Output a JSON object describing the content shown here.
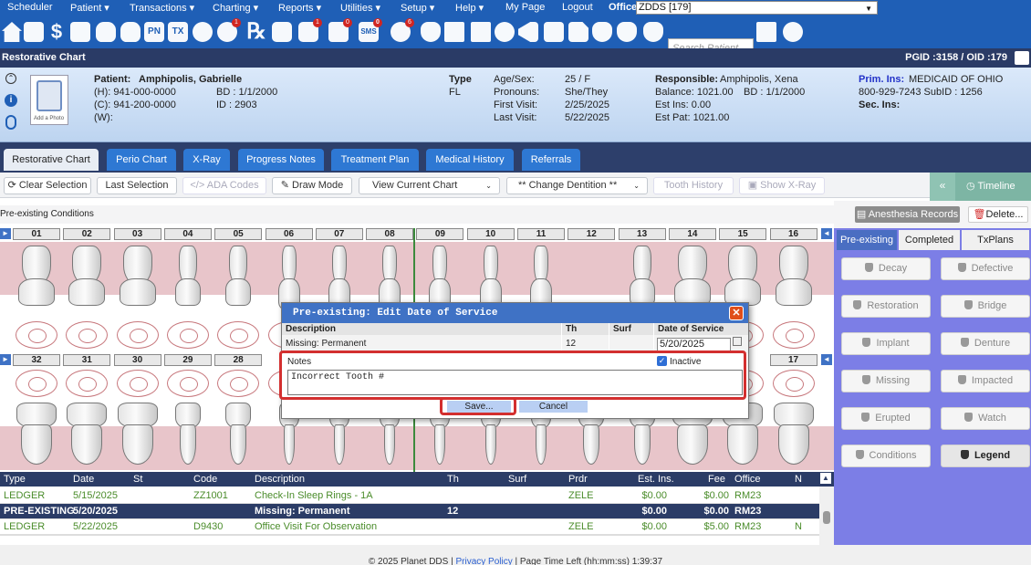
{
  "menu": {
    "items": [
      "Scheduler",
      "Patient ▾",
      "Transactions ▾",
      "Charting ▾",
      "Reports ▾",
      "Utilities ▾",
      "Setup ▾",
      "Help ▾",
      "My Page",
      "Logout"
    ],
    "office_label": "Office",
    "office_value": "ZDDS [179]"
  },
  "toolbar_icons": [
    "home-icon",
    "calendar-icon",
    "dollar-icon",
    "pen-icon",
    "tooth-icon",
    "tooth-alt-icon",
    "pn-icon",
    "tx-icon",
    "add-person-icon",
    "globe-alert-icon",
    "rx-icon",
    "message-icon",
    "chat-alert-icon",
    "notes-icon",
    "sms-icon",
    "refresh-icon",
    "insurance-icon",
    "sort-icon",
    "chart-icon",
    "globe-icon",
    "megaphone-icon",
    "printer-icon",
    "document-icon",
    "shield-check-icon",
    "arrow-shield-icon",
    "chevron-shield-icon"
  ],
  "toolbar_badges": {
    "globe_alert": "1",
    "chat_alert": "1",
    "notes": "0",
    "sms": "0",
    "refresh": "6"
  },
  "toolbar_labels": {
    "pn": "PN",
    "tx": "TX",
    "rx": "℞",
    "sms": "SMS"
  },
  "search_placeholder": "Search Patient...",
  "titlebar": {
    "title": "Restorative Chart",
    "ids": "PGID :3158  /  OID :179"
  },
  "patient": {
    "label": "Patient:",
    "name": "Amphipolis, Gabrielle",
    "home": "(H):  941-000-0000",
    "cell": "(C):  941-200-0000",
    "work": "(W):",
    "bd": "BD  :  1/1/2000",
    "id": "ID  :  2903",
    "add_photo": "Add a Photo",
    "type_label": "Type",
    "type_value": "FL",
    "age_sex_label": "Age/Sex:",
    "age_sex_value": "25 / F",
    "pronouns_label": "Pronouns:",
    "pronouns_value": "She/They",
    "first_visit_label": "First Visit:",
    "first_visit_value": "2/25/2025",
    "last_visit_label": "Last Visit:",
    "last_visit_value": "5/22/2025",
    "responsible_label": "Responsible:",
    "responsible_value": "Amphipolis, Xena",
    "balance": "Balance:  1021.00",
    "resp_bd": "BD  :  1/1/2000",
    "est_ins": "Est Ins:  0.00",
    "est_pat": "Est Pat:  1021.00",
    "prim_ins_label": "Prim. Ins:",
    "prim_ins_value": "MEDICAID OF OHIO",
    "prim_ins_detail": "800-929-7243  SubID  :  1256",
    "sec_ins_label": "Sec. Ins:"
  },
  "tabs": [
    "Restorative Chart",
    "Perio Chart",
    "X-Ray",
    "Progress Notes",
    "Treatment Plan",
    "Medical History",
    "Referrals"
  ],
  "chart_toolbar": {
    "clear_selection": "Clear Selection",
    "last_selection": "Last Selection",
    "ada_codes": "ADA Codes",
    "draw_mode": "Draw Mode",
    "view_current_chart": "View Current Chart",
    "change_dentition": "** Change Dentition **",
    "tooth_history": "Tooth History",
    "show_xray": "Show X-Ray",
    "timeline": "Timeline",
    "collapse": "«"
  },
  "preexisting_label": "Pre-existing Conditions",
  "anesthesia_records": "Anesthesia Records",
  "delete": "Delete...",
  "upper_teeth": [
    "01",
    "02",
    "03",
    "04",
    "05",
    "06",
    "07",
    "08",
    "09",
    "10",
    "11",
    "12",
    "13",
    "14",
    "15",
    "16"
  ],
  "lower_teeth_visible": [
    "32",
    "31",
    "30",
    "29",
    "28",
    "17"
  ],
  "right_tabs": [
    "Pre-existing",
    "Completed",
    "TxPlans"
  ],
  "conditions": [
    "Decay",
    "Defective",
    "Restoration",
    "Bridge",
    "Implant",
    "Denture",
    "Missing",
    "Impacted",
    "Erupted",
    "Watch",
    "Conditions",
    "Legend"
  ],
  "ledger": {
    "headers": [
      "Type",
      "Date",
      "St",
      "Code",
      "Description",
      "Th",
      "Surf",
      "Prdr",
      "Est. Ins.",
      "Fee",
      "Office",
      "N"
    ],
    "rows": [
      [
        "LEDGER",
        "5/15/2025",
        "",
        "ZZ1001",
        "Check-In Sleep Rings - 1A",
        "",
        "",
        "ZELE",
        "$0.00",
        "$0.00",
        "RM23",
        ""
      ],
      [
        "PRE-EXISTING",
        "5/20/2025",
        "",
        "",
        "Missing: Permanent",
        "12",
        "",
        "",
        "$0.00",
        "$0.00",
        "RM23",
        ""
      ],
      [
        "LEDGER",
        "5/22/2025",
        "",
        "D9430",
        "Office Visit For Observation",
        "",
        "",
        "ZELE",
        "$0.00",
        "$5.00",
        "RM23",
        "N"
      ]
    ]
  },
  "dialog": {
    "title": "Pre-existing: Edit Date of Service",
    "headers": [
      "Description",
      "Th",
      "Surf",
      "Date of Service"
    ],
    "row": {
      "description": "Missing: Permanent",
      "th": "12",
      "surf": "",
      "date": "5/20/2025"
    },
    "notes_label": "Notes",
    "inactive_label": "Inactive",
    "notes_value": "Incorrect Tooth #",
    "save": "Save...",
    "cancel": "Cancel"
  },
  "footer": {
    "copyright": "© 2025 Planet DDS",
    "privacy": "Privacy Policy",
    "time_left": "Page Time Left (hh:mm:ss) 1:39:37"
  },
  "colors": {
    "brand_blue": "#1f5fb6",
    "navy": "#2a3b66",
    "tab_blue": "#2e78d3",
    "highlight_red": "#d32f2f",
    "green_text": "#4a8c2a",
    "right_panel": "#7c7ee6"
  }
}
